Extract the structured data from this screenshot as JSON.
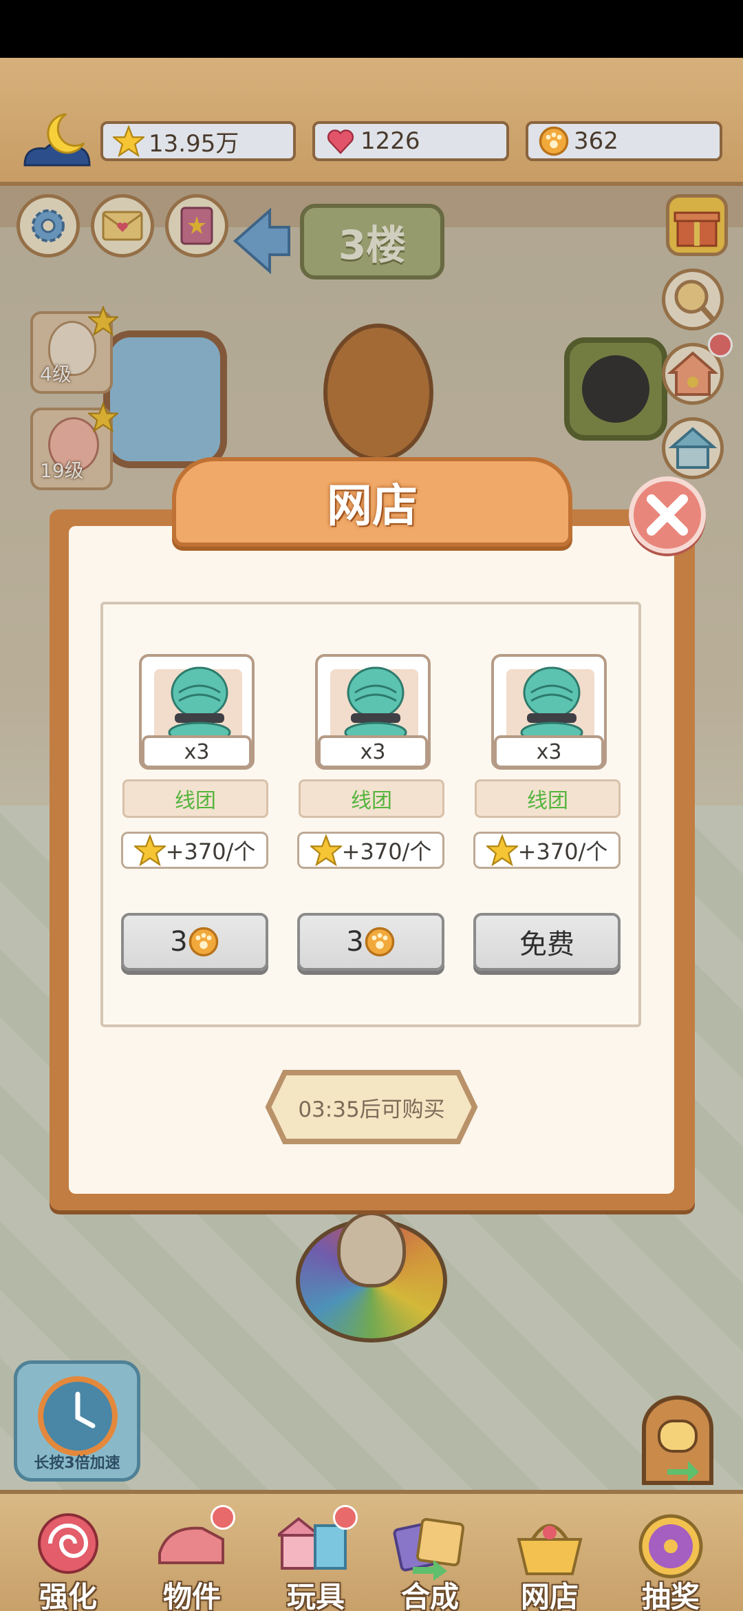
{
  "header": {
    "stars": "13.95万",
    "hearts": "1226",
    "coins": "362"
  },
  "room": {
    "floor_sign": "3楼",
    "characters": [
      {
        "level": "4级"
      },
      {
        "level": "19级"
      }
    ],
    "speedup_label": "长按3倍加速"
  },
  "shop": {
    "title": "网店",
    "items": [
      {
        "qty": "x3",
        "name": "线团",
        "reward": "+370/个",
        "price": "3",
        "price_icon": "paw-coin-icon"
      },
      {
        "qty": "x3",
        "name": "线团",
        "reward": "+370/个",
        "price": "3",
        "price_icon": "paw-coin-icon"
      },
      {
        "qty": "x3",
        "name": "线团",
        "reward": "+370/个",
        "price": "免费",
        "price_icon": ""
      }
    ],
    "timer": "03:35后可购买"
  },
  "tabs": [
    {
      "label": "强化",
      "icon": "lollipop-icon"
    },
    {
      "label": "物件",
      "icon": "piano-icon"
    },
    {
      "label": "玩具",
      "icon": "cat-house-icon"
    },
    {
      "label": "合成",
      "icon": "cards-icon"
    },
    {
      "label": "网店",
      "icon": "shop-basket-icon"
    },
    {
      "label": "抽奖",
      "icon": "prize-wheel-icon"
    }
  ],
  "colors": {
    "dialog_frame": "#c27d42",
    "title_plate": "#f0a968",
    "item_name": "#55b43d",
    "close_button": "#e9867b"
  }
}
